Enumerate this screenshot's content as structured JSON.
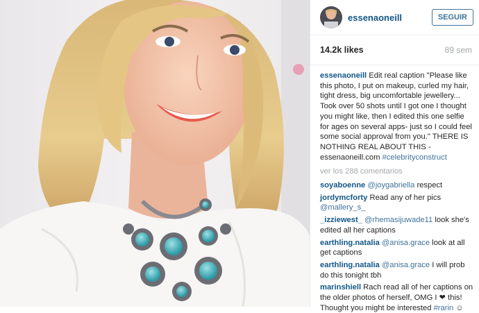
{
  "post": {
    "username": "essenaoneill",
    "follow_label": "SEGUIR",
    "likes": "14.2k likes",
    "time": "89 sem",
    "caption": {
      "username": "essenaoneill",
      "text": "Edit real caption \"Please like this photo, I put on makeup, curled my hair, tight dress, big uncomfortable jewellery... Took over 50 shots until I got one I thought you might like, then I edited this one selfie for ages on several apps- just so I could feel some social approval from you.\" THERE IS NOTHING REAL ABOUT THIS - essenaoneill.com",
      "hashtag": "#celebrityconstruct"
    },
    "view_all": "ver los 288 comentarios",
    "comments": [
      {
        "user": "soyaboenne",
        "mention": "@joygabriella",
        "text": " respect"
      },
      {
        "user": "jordymcforty",
        "mention": "",
        "text": " Read any of her pics ",
        "mention2": "@mallery_s_"
      },
      {
        "user": "_izziewest_",
        "mention": " @rhemasijuwade11",
        "text": " look she's edited all her captions"
      },
      {
        "user": "earthling.natalia",
        "mention": " @anisa.grace",
        "text": " look at all get captions"
      },
      {
        "user": "earthling.natalia",
        "mention": " @anisa.grace",
        "text": " I will prob do this tonight tbh"
      },
      {
        "user": "marinshiell",
        "mention": "",
        "text": " Rach read all of her captions on the older photos of herself, OMG I ❤ this! Thought you might be interested ",
        "mention2": "#rarin",
        "emoji": " ☺"
      }
    ]
  },
  "colors": {
    "link": "#125688",
    "mention": "#3f729b",
    "muted": "#a5a7aa"
  },
  "photo": {
    "subject": "selfie-blonde-woman-white-top-turquoise-necklace"
  }
}
